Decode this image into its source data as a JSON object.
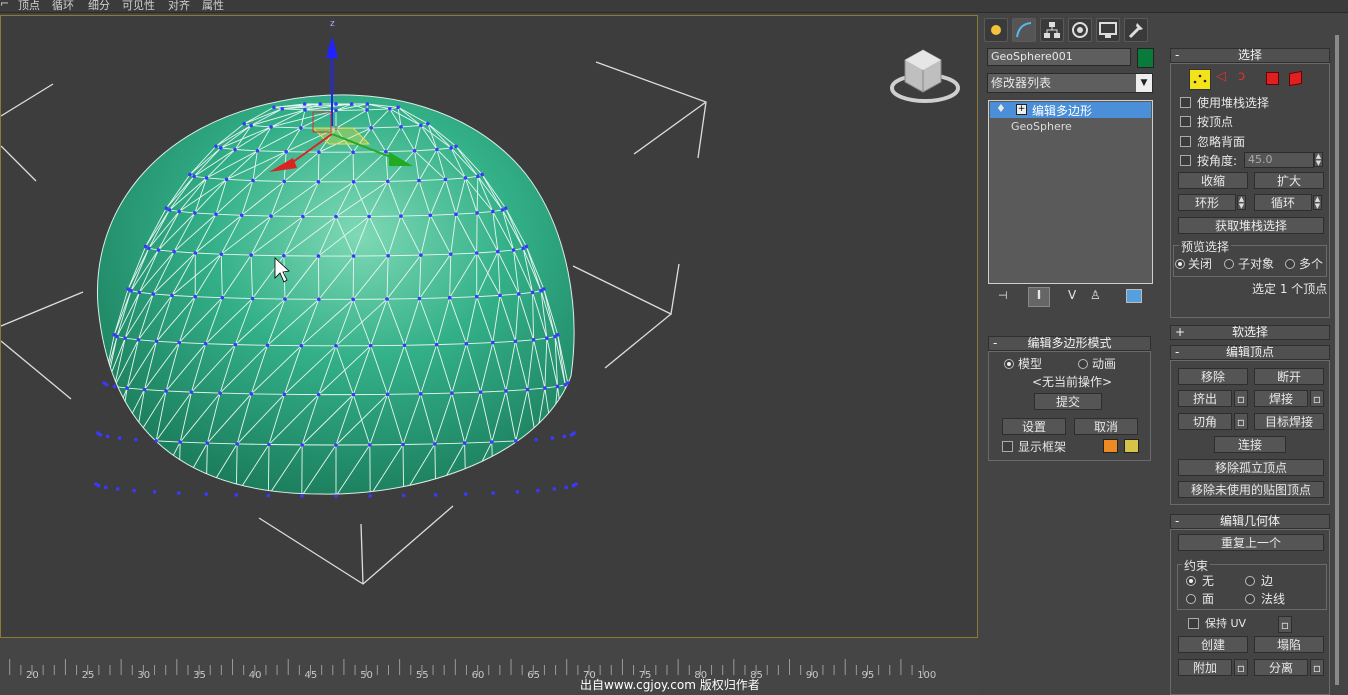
{
  "menu": {
    "items": [
      "⌐",
      "顶点",
      "循环",
      "细分",
      "可见性",
      "对齐",
      "属性"
    ]
  },
  "viewport": {
    "background": "#3d3d3d",
    "mesh_color": "#2fae86",
    "wire_color": "#ffffff",
    "vertex_color": "#3a3aff",
    "gizmo_axes": {
      "z": "#2222ff",
      "x": "#dd2222",
      "y": "#22aa22"
    },
    "axis_label": "z"
  },
  "timeline": {
    "ticks": [
      "20",
      "25",
      "30",
      "35",
      "40",
      "45",
      "50",
      "55",
      "60",
      "65",
      "70",
      "75",
      "80",
      "85",
      "90",
      "95",
      "100"
    ]
  },
  "watermark": "出自www.cgjoy.com 版权归作者",
  "panel": {
    "tab_icons": [
      "create-icon",
      "modify-icon",
      "hierarchy-icon",
      "motion-icon",
      "display-icon",
      "utilities-icon"
    ],
    "object_name": "GeoSphere001",
    "object_color": "#0a7a3a",
    "modifier_list_label": "修改器列表",
    "stack": [
      {
        "label": "编辑多边形",
        "selected": true
      },
      {
        "label": "GeoSphere",
        "selected": false
      }
    ],
    "edit_poly_mode": {
      "title": "编辑多边形模式",
      "model": "模型",
      "animate": "动画",
      "no_op": "<无当前操作>",
      "commit": "提交",
      "settings": "设置",
      "cancel": "取消",
      "show_cage": "显示框架",
      "cage_colors": [
        "#ee8a22",
        "#d8c34a"
      ]
    },
    "selection": {
      "title": "选择",
      "use_stack": "使用堆栈选择",
      "by_vertex": "按顶点",
      "ignore_backfacing": "忽略背面",
      "by_angle": "按角度:",
      "angle_value": "45.0",
      "shrink": "收缩",
      "grow": "扩大",
      "ring": "环形",
      "loop": "循环",
      "get_stack_sel": "获取堆栈选择",
      "preview_title": "预览选择",
      "preview_off": "关闭",
      "preview_subobj": "子对象",
      "preview_multi": "多个",
      "status": "选定 1 个顶点"
    },
    "soft_selection": {
      "title": "软选择"
    },
    "edit_vertices": {
      "title": "编辑顶点",
      "remove": "移除",
      "break": "断开",
      "extrude": "挤出",
      "weld": "焊接",
      "chamfer": "切角",
      "target_weld": "目标焊接",
      "connect": "连接",
      "remove_isolated": "移除孤立顶点",
      "remove_unused_map": "移除未使用的贴图顶点"
    },
    "edit_geometry": {
      "title": "编辑几何体",
      "repeat_last": "重复上一个",
      "constraints_title": "约束",
      "none": "无",
      "edge": "边",
      "face": "面",
      "normal": "法线",
      "preserve_uv": "保持 UV",
      "create": "创建",
      "collapse": "塌陷",
      "attach": "附加",
      "detach": "分离"
    }
  }
}
